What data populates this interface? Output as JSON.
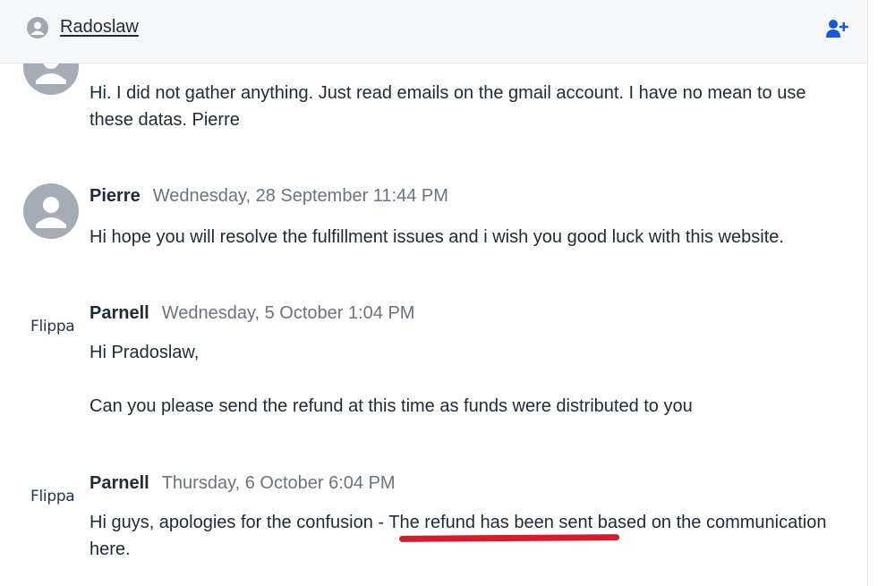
{
  "header": {
    "name": "Radoslaw",
    "user_icon": "user-circle-icon",
    "add_user_icon": "add-user-icon",
    "accent_color": "#1a56db"
  },
  "messages": [
    {
      "author": "",
      "timestamp": "",
      "lines": [
        "Hi. I did not gather anything. Just read emails on the gmail account. I have no mean to use these datas. Pierre"
      ]
    },
    {
      "author": "Pierre",
      "timestamp": "Wednesday, 28 September 11:44 PM",
      "lines": [
        "Hi hope you will resolve the fulfillment issues and i wish you good luck with this website."
      ]
    },
    {
      "author": "Parnell",
      "logo": "Flippa",
      "timestamp": "Wednesday, 5 October 1:04 PM",
      "lines": [
        "Hi Pradoslaw,",
        "Can you please send the refund at this time as funds were distributed to you"
      ]
    },
    {
      "author": "Parnell",
      "logo": "Flippa",
      "timestamp": "Thursday, 6 October 6:04 PM",
      "lines": [
        "Hi guys, apologies for the confusion - The refund has been sent based on the communication here."
      ]
    }
  ],
  "annotation_color": "#d81b2c"
}
